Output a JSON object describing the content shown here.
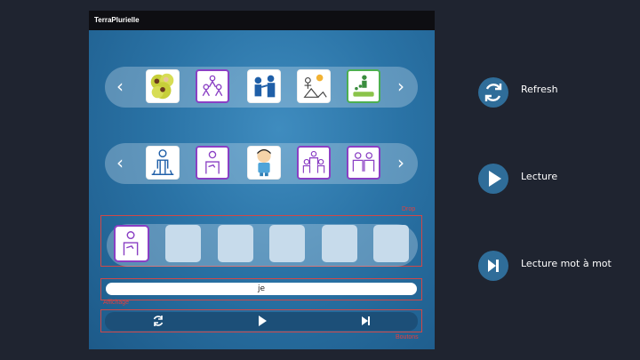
{
  "app": {
    "title": "TerraPlurielle"
  },
  "carousel_top": {
    "prev_label": "‹",
    "next_label": "›",
    "cards": [
      {
        "icon": "group-faces-pictogram",
        "border": "#f2f2f2"
      },
      {
        "icon": "family-pictogram",
        "border": "#8a3fc4"
      },
      {
        "icon": "people-talking-pictogram",
        "border": "#f2f2f2"
      },
      {
        "icon": "camping-pictogram",
        "border": "#f2f2f2"
      },
      {
        "icon": "actions-pictogram",
        "border": "#4caf50"
      }
    ]
  },
  "carousel_bottom": {
    "prev_label": "‹",
    "next_label": "›",
    "cards": [
      {
        "icon": "person-standing-pictogram",
        "border": "#f2f2f2"
      },
      {
        "icon": "me-pictogram",
        "border": "#8a3fc4"
      },
      {
        "icon": "child-cartoon-pictogram",
        "border": "#f2f2f2"
      },
      {
        "icon": "group-pictogram",
        "border": "#8a3fc4"
      },
      {
        "icon": "two-people-pictogram",
        "border": "#8a3fc4"
      }
    ]
  },
  "drop_zone": {
    "label": "Drop",
    "slots": [
      {
        "filled": true,
        "icon": "me-pictogram"
      },
      {
        "filled": false
      },
      {
        "filled": false
      },
      {
        "filled": false
      },
      {
        "filled": false
      },
      {
        "filled": false
      }
    ]
  },
  "display_zone": {
    "label": "Affichage",
    "text": "je"
  },
  "controls_zone": {
    "label": "Boutons"
  },
  "side_controls": [
    {
      "icon": "refresh-icon",
      "label": "Refresh"
    },
    {
      "icon": "play-icon",
      "label": "Lecture"
    },
    {
      "icon": "skip-next-icon",
      "label": "Lecture mot à mot"
    }
  ],
  "colors": {
    "accent_purple": "#8a3fc4",
    "accent_green": "#4caf50",
    "zone_outline": "#d04848",
    "side_button": "#2f6d99"
  }
}
